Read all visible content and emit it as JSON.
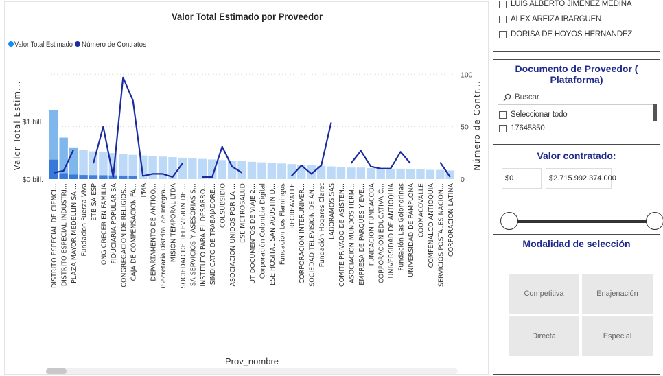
{
  "chart": {
    "title": "Valor Total Estimado por Proveedor",
    "y_left_label": "Valor Total Estim...",
    "y_right_label": "Número de Contr...",
    "x_label": "Prov_nombre"
  },
  "chart_data": {
    "type": "bar",
    "title": "Valor Total Estimado por Proveedor",
    "xlabel": "Prov_nombre",
    "ylabel": "Valor Total Estim...",
    "y2label": "Número de Contr...",
    "legend_position": "top-left",
    "ylim": [
      0,
      2.0
    ],
    "y_ticks": [
      {
        "v": 0,
        "label": "$0 bill."
      },
      {
        "v": 1,
        "label": "$1 bill."
      }
    ],
    "y2lim": [
      0,
      110
    ],
    "y2_ticks": [
      0,
      50,
      100
    ],
    "series": [
      {
        "name": "Valor Total Estimado",
        "color": "#118DFF",
        "kind": "bar"
      },
      {
        "name": "Número de Contratos",
        "color": "#1a2aa0",
        "kind": "line"
      }
    ],
    "categories": [
      "DISTRITO ESPECIAL DE CIENCI...",
      "DISTRITO ESPECIAL INDUSTRI...",
      "PLAZA MAYOR MEDELLIN SA ...",
      "Fundacion Fuerza Viva",
      "ETB SA ESP",
      "ONG CRECER EN FAMILIA",
      "FIDUCIARIA POPULAR SA",
      "CONGREGACION DE RELIGIOS...",
      "CAJA DE COMPENSACION FA...",
      "PMA",
      "DEPARTAMENTO DE ANTIOQ...",
      "(Secretaria Distrital de Integra...",
      "MISION TEMPORAL LTDA",
      "SOCIEDAD DE TELEVISION DE ...",
      "SA SERVICIOS Y ASESORIAS S...",
      "INSTITUTO PARA EL DESARRO...",
      "SINDICATO DE TRABAJADORE...",
      "COLSUBSIDIO",
      "ASOCIACION UNIDOS POR LA ...",
      "ESE METROSALUD",
      "UT DOCUMENTOS DE VIAJE 2...",
      "Corporación Colombia Digital",
      "ESE HOSITAL SAN AGUSTIN D...",
      "Fundacion Los Flamingos",
      "RECREAVALLE",
      "CORPORACION INTERUNIVER...",
      "SOCIEDAD TELEVISION DE AN...",
      "Fundación Hogares Claret",
      "LABORAMOS SAS",
      "COMITE PRIVADO DE ASISTEN...",
      "ASOCIACION MUNDOS HERM...",
      "EMPRESA DE PARQUES Y EVE...",
      "FUNDACION FUNDACOBA",
      "CORPORACION EDUCATIVA C...",
      "UNIVERSIDAD DE ANTIOQUIA",
      "Fundación Las Golondrinas",
      "UNIVERSIDAD DE PAMPLONA",
      "COOMACOVALLE",
      "COMFENALCO ANTIOQUIA",
      "SERVICIOS POSTALES NACION...",
      "CORPORACION LATINA"
    ],
    "values_bill": [
      1.2,
      0.72,
      0.55,
      0.5,
      0.48,
      0.47,
      0.45,
      0.43,
      0.42,
      0.41,
      0.4,
      0.39,
      0.38,
      0.37,
      0.36,
      0.35,
      0.34,
      0.33,
      0.32,
      0.31,
      0.3,
      0.29,
      0.28,
      0.27,
      0.26,
      0.25,
      0.24,
      0.23,
      0.22,
      0.21,
      0.2,
      0.2,
      0.19,
      0.19,
      0.18,
      0.18,
      0.17,
      0.17,
      0.16,
      0.16,
      0.15
    ],
    "contracts": [
      6,
      8,
      28,
      null,
      15,
      50,
      2,
      97,
      75,
      3,
      5,
      5,
      2,
      15,
      null,
      2,
      2,
      31,
      12,
      6,
      null,
      null,
      null,
      null,
      3,
      13,
      5,
      13,
      54,
      null,
      15,
      27,
      12,
      10,
      10,
      26,
      15,
      null,
      null,
      16,
      2,
      14
    ]
  },
  "slicer_names": {
    "items": [
      "LUIS ALBERTO JIMENEZ MEDINA",
      "ALEX AREIZA IBARGUEN",
      "DORISA DE HOYOS HERNANDEZ"
    ]
  },
  "slicer_doc": {
    "title": "Documento de Proveedor ( Plataforma)",
    "search_placeholder": "Buscar",
    "select_all": "Seleccionar todo",
    "first_item": "17645850"
  },
  "slicer_valor": {
    "title": "Valor contratado:",
    "min": "$0",
    "max": "$2.715.992.374.000",
    "range_fraction": [
      0.0,
      1.0
    ]
  },
  "slicer_modalidad": {
    "title": "Modalidad de selección",
    "tiles": [
      "Competitiva",
      "Enajenación",
      "Directa",
      "Especial"
    ]
  }
}
